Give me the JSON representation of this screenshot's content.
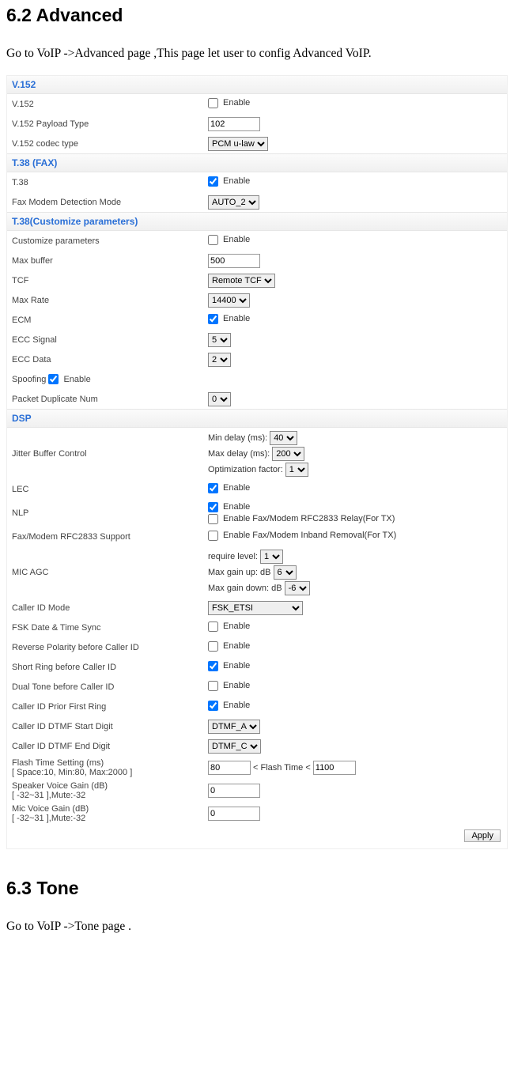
{
  "headings": {
    "advanced": "6.2 Advanced",
    "advanced_intro": "Go to VoIP ->Advanced page ,This page let user to config Advanced VoIP.",
    "tone": "6.3 Tone",
    "tone_intro": "Go to VoIP ->Tone page ."
  },
  "apply_label": "Apply",
  "enable_label": "Enable",
  "groups": {
    "v152": {
      "title": "V.152",
      "v152_label": "V.152",
      "v152_enabled": false,
      "payload_label": "V.152 Payload Type",
      "payload_value": "102",
      "codec_label": "V.152 codec type",
      "codec_value": "PCM u-law"
    },
    "t38": {
      "title": "T.38 (FAX)",
      "t38_label": "T.38",
      "t38_enabled": true,
      "detection_label": "Fax Modem Detection Mode",
      "detection_value": "AUTO_2"
    },
    "t38c": {
      "title": "T.38(Customize parameters)",
      "custom_label": "Customize parameters",
      "custom_enabled": false,
      "maxbuf_label": "Max buffer",
      "maxbuf_value": "500",
      "tcf_label": "TCF",
      "tcf_value": "Remote TCF",
      "maxrate_label": "Max Rate",
      "maxrate_value": "14400",
      "ecm_label": "ECM",
      "ecm_enabled": true,
      "eccs_label": "ECC Signal",
      "eccs_value": "5",
      "eccd_label": "ECC Data",
      "eccd_value": "2",
      "spoof_label": "Spoofing",
      "spoof_enabled": true,
      "pdn_label": "Packet Duplicate Num",
      "pdn_value": "0"
    },
    "dsp": {
      "title": "DSP",
      "jbc_label": "Jitter Buffer Control",
      "jbc_min_label": "Min delay (ms):",
      "jbc_min_value": "40",
      "jbc_max_label": "Max delay (ms):",
      "jbc_max_value": "200",
      "jbc_opt_label": "Optimization factor:",
      "jbc_opt_value": "1",
      "lec_label": "LEC",
      "lec_enabled": true,
      "nlp_label": "NLP",
      "nlp_enabled": true,
      "fax_relay_label": "Enable Fax/Modem RFC2833 Relay(For TX)",
      "fax_relay_enabled": false,
      "fm2833_label": "Fax/Modem RFC2833 Support",
      "fax_inband_label": "Enable Fax/Modem Inband Removal(For TX)",
      "fax_inband_enabled": false,
      "agc_label": "MIC AGC",
      "agc_req_label": "require level:",
      "agc_req_value": "1",
      "agc_up_label": "Max gain up: dB",
      "agc_up_value": "6",
      "agc_down_label": "Max gain down: dB",
      "agc_down_value": "-6",
      "cid_mode_label": "Caller ID Mode",
      "cid_mode_value": "FSK_ETSI",
      "fsk_sync_label": "FSK Date & Time Sync",
      "fsk_sync_enabled": false,
      "revpol_label": "Reverse Polarity before Caller ID",
      "revpol_enabled": false,
      "shortring_label": "Short Ring before Caller ID",
      "shortring_enabled": true,
      "dualtone_label": "Dual Tone before Caller ID",
      "dualtone_enabled": false,
      "priorring_label": "Caller ID Prior First Ring",
      "priorring_enabled": true,
      "dtmf_start_label": "Caller ID DTMF Start Digit",
      "dtmf_start_value": "DTMF_A",
      "dtmf_end_label": "Caller ID DTMF End Digit",
      "dtmf_end_value": "DTMF_C",
      "flash_label_line1": "Flash Time Setting (ms)",
      "flash_label_line2": "[ Space:10, Min:80, Max:2000 ]",
      "flash_low": "80",
      "flash_mid": " < Flash Time < ",
      "flash_high": "1100",
      "spk_gain_label_line1": "Speaker Voice Gain (dB)",
      "spk_gain_label_line2": "[ -32~31 ],Mute:-32",
      "spk_gain_value": "0",
      "mic_gain_label_line1": "Mic Voice Gain (dB)",
      "mic_gain_label_line2": "[ -32~31 ],Mute:-32",
      "mic_gain_value": "0"
    }
  }
}
